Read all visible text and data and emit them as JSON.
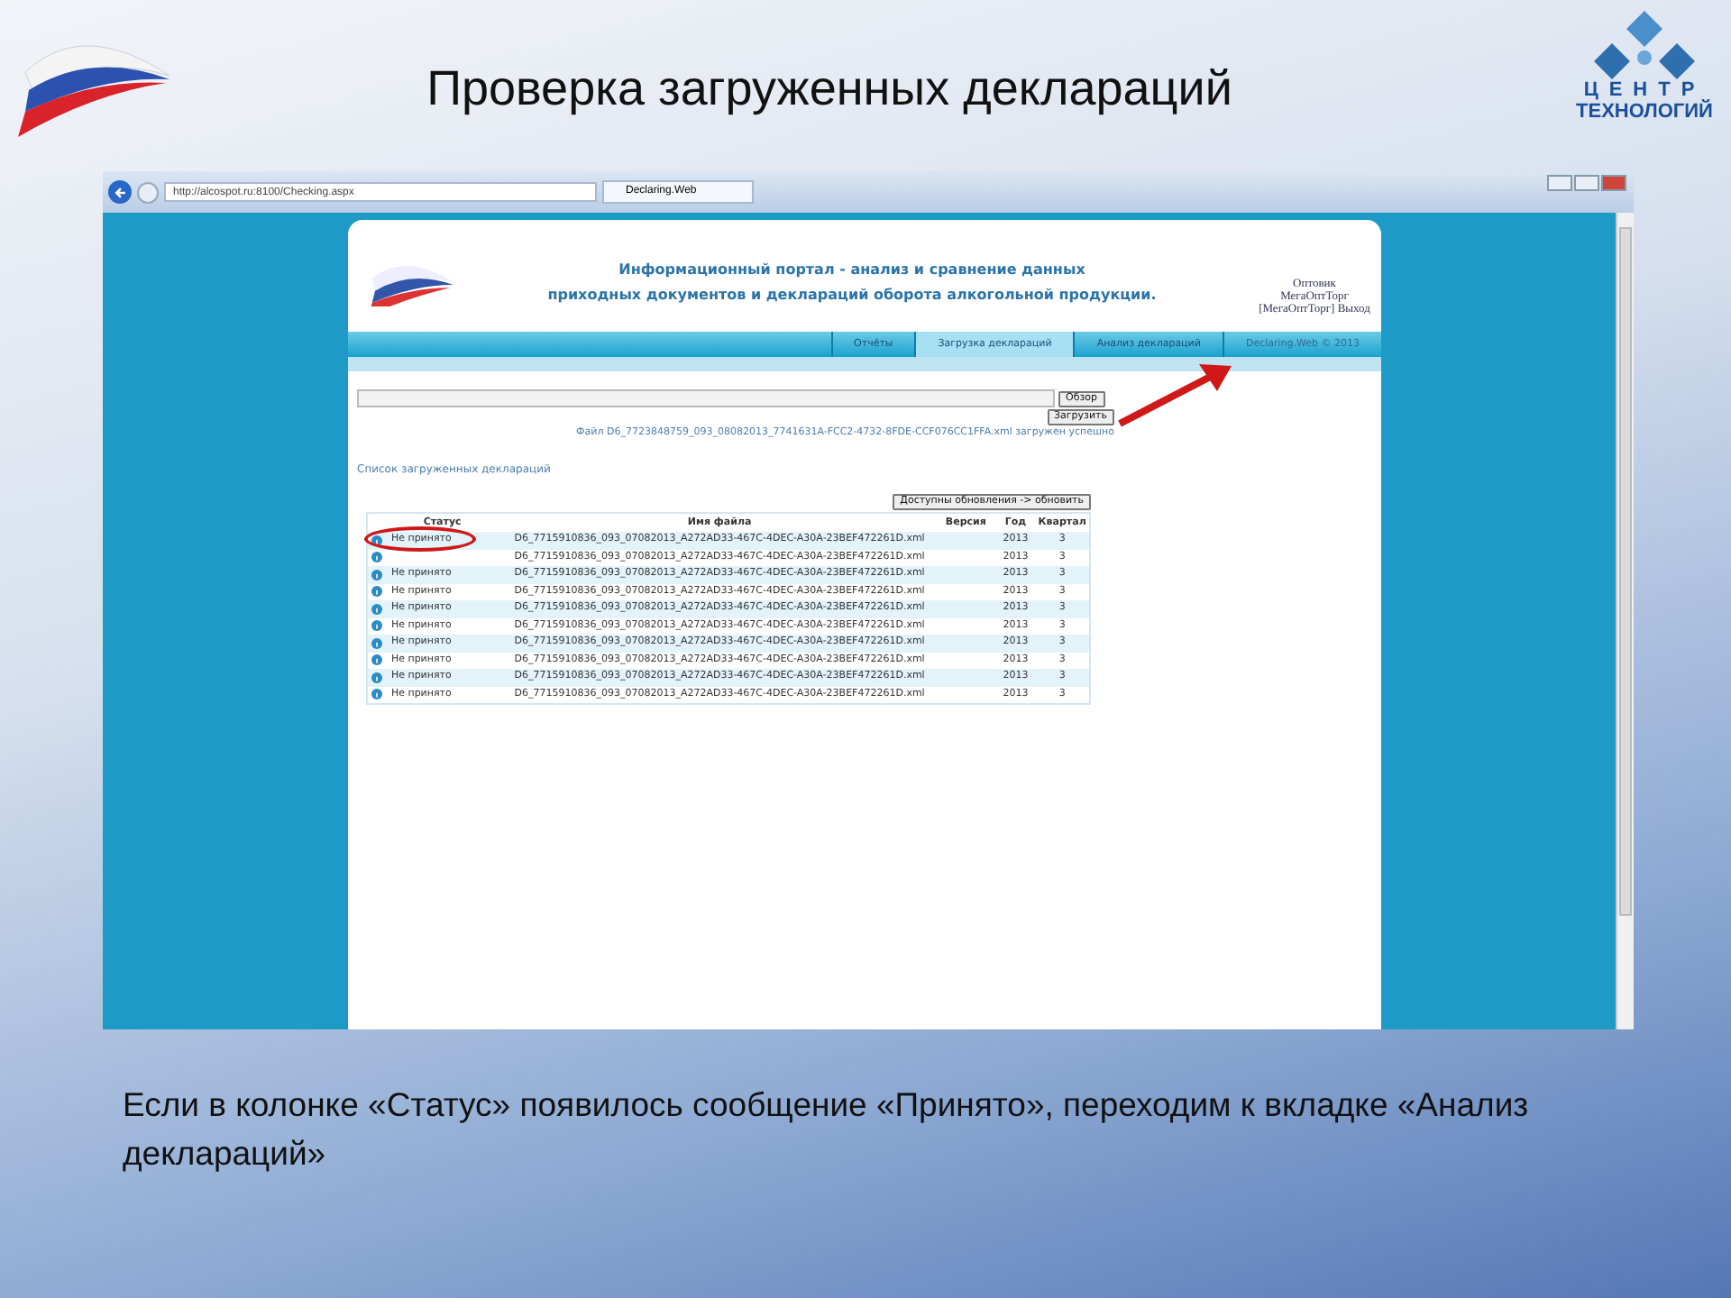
{
  "slide": {
    "title": "Проверка загруженных деклараций",
    "logo": {
      "line1": "ЦЕНТР",
      "line2": "ТЕХНОЛОГИЙ"
    },
    "caption": "Если в колонке «Статус» появилось сообщение «Принято», переходим к вкладке «Анализ деклараций»"
  },
  "browser": {
    "address": "http://alcospot.ru:8100/Checking.aspx",
    "tab": "Declaring.Web"
  },
  "portal": {
    "heading_lines": [
      "Информационный портал - анализ и сравнение данных",
      "приходных документов и деклараций оборота алкогольной продукции."
    ],
    "user": {
      "role": "Оптовик",
      "company": "МегаОптТорг",
      "account": "[МегаОптТорг]",
      "logout": "Выход"
    },
    "nav": [
      {
        "label": "Отчёты",
        "selected": false
      },
      {
        "label": "Загрузка деклараций",
        "selected": true
      },
      {
        "label": "Анализ деклараций",
        "selected": false
      }
    ],
    "footer_tab": "Declaring.Web © 2013"
  },
  "upload": {
    "browse_button": "Обзор",
    "upload_button": "Загрузить",
    "message": "Файл D6_7723848759_093_08082013_7741631A-FCC2-4732-8FDE-CCF076CC1FFA.xml загружен успешно"
  },
  "list_title": "Список загруженных деклараций",
  "refresh_button": "Доступны обновления -> обновить",
  "table": {
    "columns": [
      "Статус",
      "Имя файла",
      "Версия",
      "Год",
      "Квартал"
    ],
    "rows": [
      {
        "status": "Не принято",
        "file": "D6_7715910836_093_07082013_A272AD33-467C-4DEC-A30A-23BEF472261D.xml",
        "year": "2013",
        "quarter": "3",
        "circled": true
      },
      {
        "file": "D6_7715910836_093_07082013_A272AD33-467C-4DEC-A30A-23BEF472261D.xml",
        "year": "2013",
        "quarter": "3",
        "circled": false
      },
      {
        "status": "Не принято",
        "file": "D6_7715910836_093_07082013_A272AD33-467C-4DEC-A30A-23BEF472261D.xml",
        "year": "2013",
        "quarter": "3",
        "circled": false
      },
      {
        "status": "Не принято",
        "file": "D6_7715910836_093_07082013_A272AD33-467C-4DEC-A30A-23BEF472261D.xml",
        "year": "2013",
        "quarter": "3",
        "circled": false
      },
      {
        "status": "Не принято",
        "file": "D6_7715910836_093_07082013_A272AD33-467C-4DEC-A30A-23BEF472261D.xml",
        "year": "2013",
        "quarter": "3",
        "circled": false
      },
      {
        "status": "Не принято",
        "file": "D6_7715910836_093_07082013_A272AD33-467C-4DEC-A30A-23BEF472261D.xml",
        "year": "2013",
        "quarter": "3",
        "circled": false
      },
      {
        "status": "Не принято",
        "file": "D6_7715910836_093_07082013_A272AD33-467C-4DEC-A30A-23BEF472261D.xml",
        "year": "2013",
        "quarter": "3",
        "circled": false
      },
      {
        "status": "Не принято",
        "file": "D6_7715910836_093_07082013_A272AD33-467C-4DEC-A30A-23BEF472261D.xml",
        "year": "2013",
        "quarter": "3",
        "circled": false
      },
      {
        "status": "Не принято",
        "file": "D6_7715910836_093_07082013_A272AD33-467C-4DEC-A30A-23BEF472261D.xml",
        "year": "2013",
        "quarter": "3",
        "circled": false
      },
      {
        "status": "Не принято",
        "file": "D6_7715910836_093_07082013_A272AD33-467C-4DEC-A30A-23BEF472261D.xml",
        "year": "2013",
        "quarter": "3",
        "circled": false
      }
    ]
  }
}
